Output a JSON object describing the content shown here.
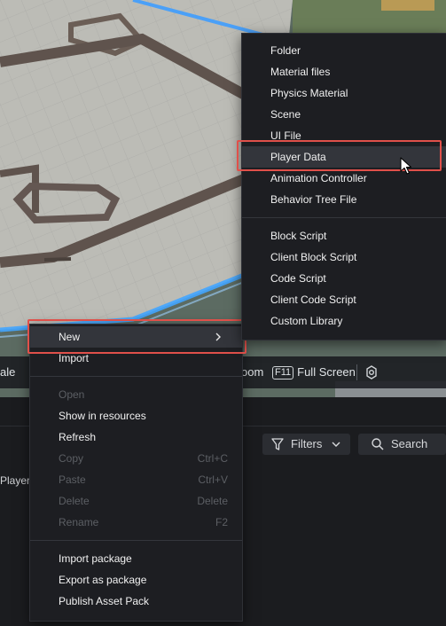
{
  "viewport_toolbar": {
    "scale_label": "ale",
    "zoom_label": "oom",
    "fullscreen_key": "F11",
    "fullscreen_label": "Full Screen",
    "settings_icon": "gear-icon"
  },
  "asset_panel": {
    "filters_label": "Filters",
    "search_label": "Search",
    "item_label": "Playerd"
  },
  "context_menu": {
    "new": "New",
    "import": "Import",
    "open": "Open",
    "show_in_resources": "Show in resources",
    "refresh": "Refresh",
    "copy": "Copy",
    "copy_shortcut": "Ctrl+C",
    "paste": "Paste",
    "paste_shortcut": "Ctrl+V",
    "delete": "Delete",
    "delete_shortcut": "Delete",
    "rename": "Rename",
    "rename_shortcut": "F2",
    "import_package": "Import package",
    "export_as_package": "Export as package",
    "publish_asset_pack": "Publish Asset Pack"
  },
  "new_submenu": {
    "folder": "Folder",
    "material_files": "Material files",
    "physics_material": "Physics Material",
    "scene": "Scene",
    "ui_file": "UI File",
    "player_data": "Player Data",
    "animation_controller": "Animation Controller",
    "behavior_tree_file": "Behavior Tree File",
    "block_script": "Block Script",
    "client_block_script": "Client Block Script",
    "code_script": "Code Script",
    "client_code_script": "Client Code Script",
    "custom_library": "Custom Library"
  },
  "colors": {
    "highlight_outline": "#e0504a",
    "menu_background": "#1d1e22",
    "disabled_text": "#5c5f64"
  }
}
